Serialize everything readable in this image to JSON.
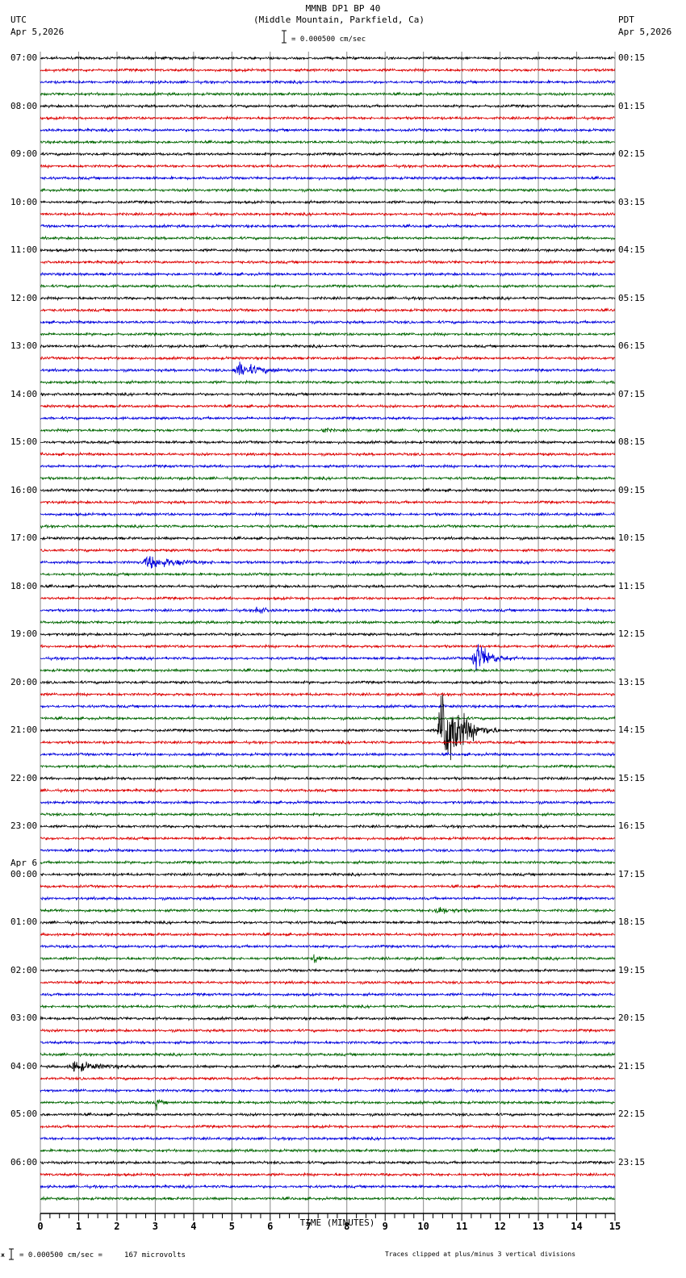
{
  "header": {
    "title": "MMNB DP1 BP 40",
    "subtitle": "(Middle Mountain, Parkfield, Ca)",
    "left_tz": "UTC",
    "left_date": "Apr 5,2026",
    "right_tz": "PDT",
    "right_date": "Apr 5,2026",
    "scale": "= 0.000500 cm/sec"
  },
  "footer": {
    "scale_prefix": "ж",
    "scale": "= 0.000500 cm/sec =     167 microvolts",
    "clip_note": "Traces clipped at plus/minus 3 vertical divisions"
  },
  "chart_data": {
    "type": "line",
    "xlabel": "TIME (MINUTES)",
    "xlim": [
      0,
      15
    ],
    "xticks": [
      "0",
      "1",
      "2",
      "3",
      "4",
      "5",
      "6",
      "7",
      "8",
      "9",
      "10",
      "11",
      "12",
      "13",
      "14",
      "15"
    ],
    "trace_count": 96,
    "trace_minutes": 15,
    "trace_colors": [
      "#000000",
      "#dd0000",
      "#0000dd",
      "#006600"
    ],
    "clip_divisions": 3,
    "left_labels": [
      "07:00",
      "08:00",
      "09:00",
      "10:00",
      "11:00",
      "12:00",
      "13:00",
      "14:00",
      "15:00",
      "16:00",
      "17:00",
      "18:00",
      "19:00",
      "20:00",
      "21:00",
      "22:00",
      "23:00",
      "00:00",
      "01:00",
      "02:00",
      "03:00",
      "04:00",
      "05:00",
      "06:00"
    ],
    "date_change_label": "Apr 6",
    "date_change_hour_index": 17,
    "right_labels": [
      "00:15",
      "01:15",
      "02:15",
      "03:15",
      "04:15",
      "05:15",
      "06:15",
      "07:15",
      "08:15",
      "09:15",
      "10:15",
      "11:15",
      "12:15",
      "13:15",
      "14:15",
      "15:15",
      "16:15",
      "17:15",
      "18:15",
      "19:15",
      "20:15",
      "21:15",
      "22:15",
      "23:15"
    ],
    "events": [
      {
        "trace": 26,
        "start_min": 5.0,
        "duration_min": 2.0,
        "amplitude": 0.4
      },
      {
        "trace": 31,
        "start_min": 7.3,
        "duration_min": 0.5,
        "amplitude": 0.2
      },
      {
        "trace": 42,
        "start_min": 2.6,
        "duration_min": 2.5,
        "amplitude": 0.35
      },
      {
        "trace": 46,
        "start_min": 5.6,
        "duration_min": 0.6,
        "amplitude": 0.3
      },
      {
        "trace": 50,
        "start_min": 11.25,
        "duration_min": 1.2,
        "amplitude": 1.0
      },
      {
        "trace": 56,
        "start_min": 10.35,
        "duration_min": 1.6,
        "amplitude": 3.0
      },
      {
        "trace": 71,
        "start_min": 10.2,
        "duration_min": 1.2,
        "amplitude": 0.25
      },
      {
        "trace": 75,
        "start_min": 7.1,
        "duration_min": 0.5,
        "amplitude": 0.3
      },
      {
        "trace": 84,
        "start_min": 0.7,
        "duration_min": 2.0,
        "amplitude": 0.3
      },
      {
        "trace": 87,
        "start_min": 3.0,
        "duration_min": 0.3,
        "amplitude": 0.35
      }
    ]
  }
}
